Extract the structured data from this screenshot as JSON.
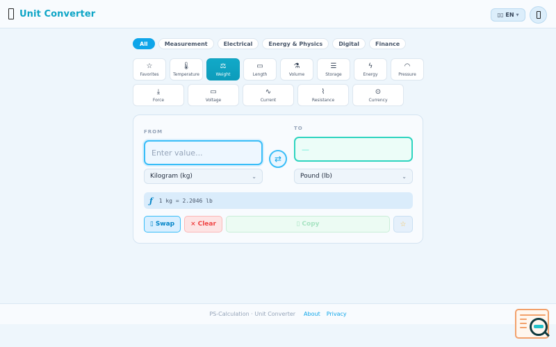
{
  "header": {
    "title": "Unit Converter",
    "lang_label": "EN",
    "icons": {
      "brand": "phone-icon",
      "language": "globe-icon",
      "menu": "phone-icon"
    }
  },
  "categories": [
    {
      "label": "All",
      "active": true
    },
    {
      "label": "Measurement",
      "active": false
    },
    {
      "label": "Electrical",
      "active": false
    },
    {
      "label": "Energy & Physics",
      "active": false
    },
    {
      "label": "Digital",
      "active": false
    },
    {
      "label": "Finance",
      "active": false
    }
  ],
  "units_row1": [
    {
      "label": "Favorites",
      "icon": "star-icon",
      "glyph": "☆",
      "active": false
    },
    {
      "label": "Temperature",
      "icon": "thermometer-icon",
      "glyph": "🌡",
      "active": false
    },
    {
      "label": "Weight",
      "icon": "scale-icon",
      "glyph": "⚖",
      "active": true
    },
    {
      "label": "Length",
      "icon": "ruler-icon",
      "glyph": "▭",
      "active": false
    },
    {
      "label": "Volume",
      "icon": "flask-icon",
      "glyph": "⚗",
      "active": false
    },
    {
      "label": "Storage",
      "icon": "storage-icon",
      "glyph": "☰",
      "active": false
    },
    {
      "label": "Energy",
      "icon": "lightning-icon",
      "glyph": "ϟ",
      "active": false
    },
    {
      "label": "Pressure",
      "icon": "gauge-icon",
      "glyph": "◠",
      "active": false
    }
  ],
  "units_row2": [
    {
      "label": "Force",
      "icon": "arrow-down-icon",
      "glyph": "⤓",
      "active": false
    },
    {
      "label": "Voltage",
      "icon": "battery-icon",
      "glyph": "▭",
      "active": false
    },
    {
      "label": "Current",
      "icon": "wave-icon",
      "glyph": "∿",
      "active": false
    },
    {
      "label": "Resistance",
      "icon": "resistor-icon",
      "glyph": "⌇",
      "active": false
    },
    {
      "label": "Currency",
      "icon": "coin-icon",
      "glyph": "⊙",
      "active": false
    }
  ],
  "converter": {
    "from_label": "FROM",
    "to_label": "TO",
    "from_placeholder": "Enter value...",
    "to_value": "—",
    "from_unit": "Kilogram (kg)",
    "to_unit": "Pound (lb)",
    "formula": "1 kg = 2.2046 lb",
    "formula_icon": "ƒ",
    "swap_icon": "⇄",
    "swap_label": "Swap",
    "clear_label": "Clear",
    "copy_label": "Copy",
    "favorite_icon": "☆"
  },
  "footer": {
    "brand": "PS-Calculation · Unit Converter",
    "about": "About",
    "privacy": "Privacy"
  },
  "colors": {
    "accent": "#0ea5e9",
    "teal": "#14b8a6",
    "danger": "#ef4444",
    "background": "#eef6fc"
  }
}
